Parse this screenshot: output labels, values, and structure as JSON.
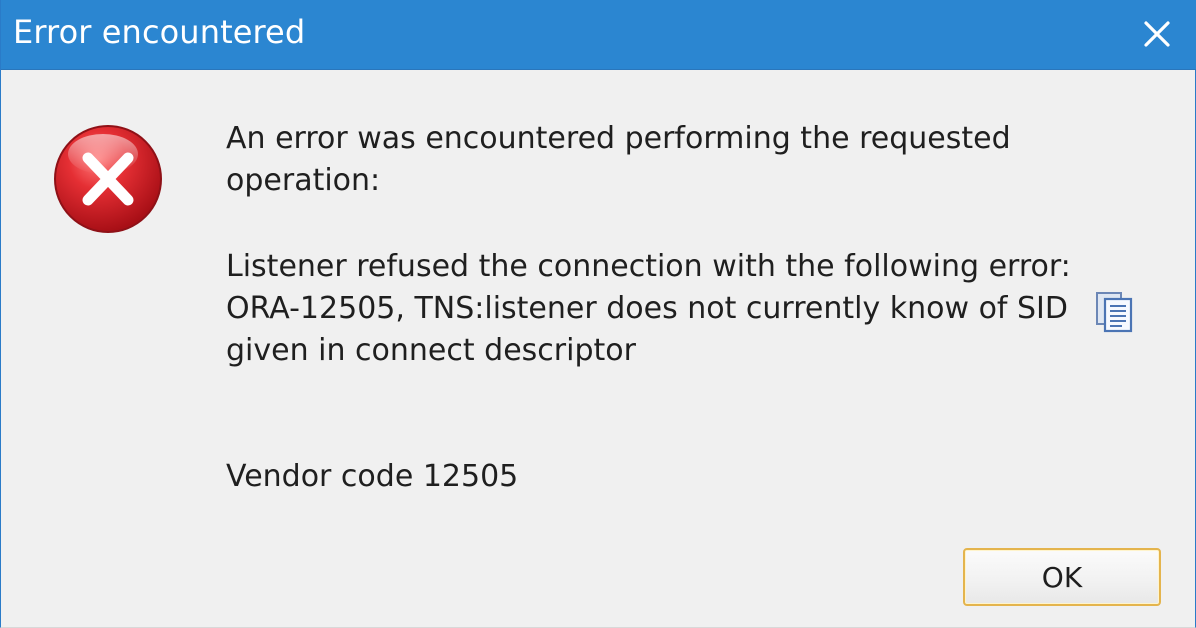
{
  "dialog": {
    "title": "Error encountered",
    "close_icon": "close-icon",
    "error_icon": "error-icon"
  },
  "message": {
    "line_1": "An error was encountered performing the requested",
    "line_2": "operation:",
    "line_3": "Listener refused the connection with the following error:",
    "line_4": "ORA-12505, TNS:listener does not currently know of SID",
    "line_5": "given in connect descriptor",
    "vendor_code": "Vendor code 12505",
    "copy_icon": "copy-icon"
  },
  "buttons": {
    "ok_label": "OK"
  },
  "colors": {
    "titlebar": "#2b86d1",
    "dialog_background": "#f0f0f0",
    "error_red": "#d8232a",
    "button_focus": "#e4b44d"
  }
}
